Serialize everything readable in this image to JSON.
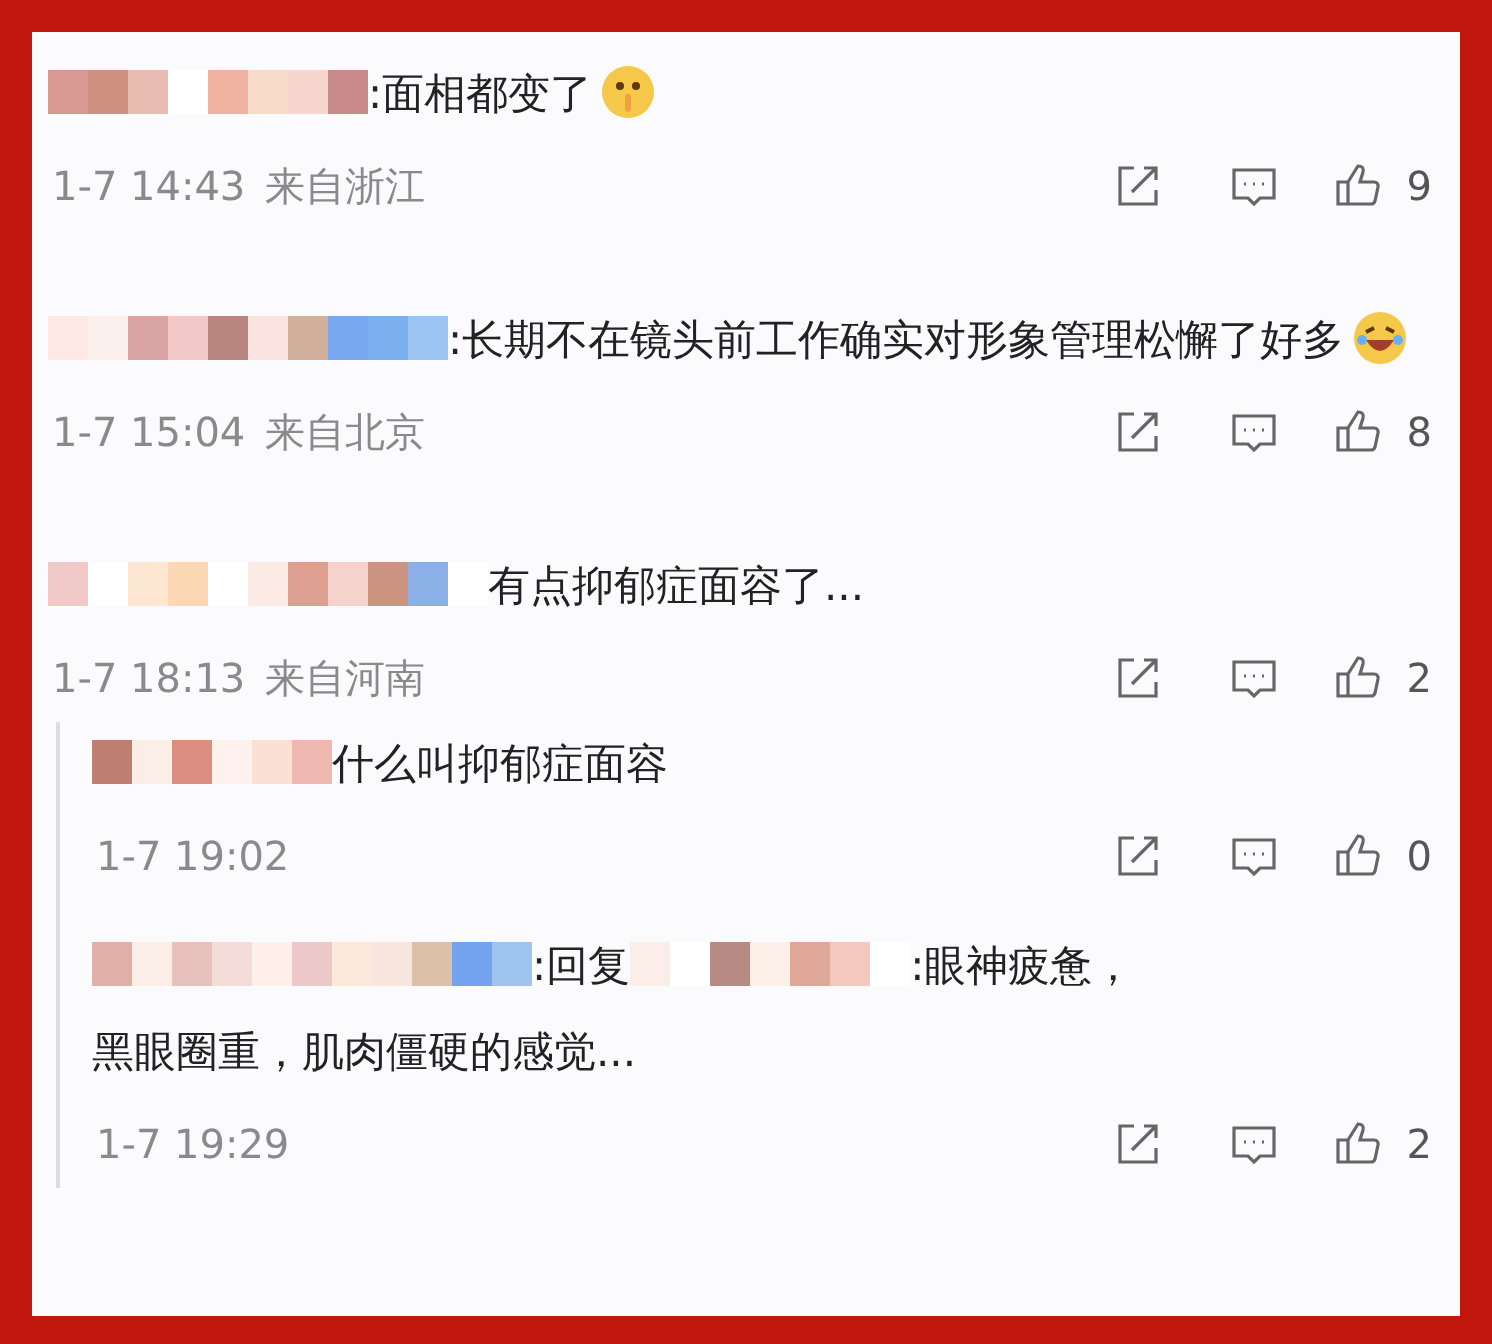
{
  "comments": [
    {
      "parts": [
        {
          "kind": "name"
        },
        {
          "kind": "text",
          "text": ":面相都变了"
        },
        {
          "kind": "shush"
        }
      ],
      "time": "1-7 14:43",
      "location": "来自浙江",
      "likes": "9"
    },
    {
      "parts": [
        {
          "kind": "name"
        },
        {
          "kind": "text",
          "text": ":长期不在镜头前工作确实对形象管理"
        },
        {
          "kind": "text",
          "text": "松懈了好多"
        },
        {
          "kind": "laugh"
        }
      ],
      "time": "1-7 15:04",
      "location": "来自北京",
      "likes": "8"
    },
    {
      "parts": [
        {
          "kind": "name"
        },
        {
          "kind": "text",
          "text": "有点抑郁症面容了..."
        }
      ],
      "time": "1-7 18:13",
      "location": "来自河南",
      "likes": "2",
      "replies": [
        {
          "parts": [
            {
              "kind": "name"
            },
            {
              "kind": "text",
              "text": "什么叫抑郁症面容"
            }
          ],
          "time": "1-7 19:02",
          "likes": "0"
        },
        {
          "parts": [
            {
              "kind": "name"
            },
            {
              "kind": "text",
              "text": ":回复"
            },
            {
              "kind": "name"
            },
            {
              "kind": "text",
              "text": ":眼神疲惫，"
            },
            {
              "kind": "text",
              "text": "黑眼圈重，肌肉僵硬的感觉..."
            }
          ],
          "time": "1-7 19:29",
          "likes": "2"
        }
      ]
    }
  ]
}
